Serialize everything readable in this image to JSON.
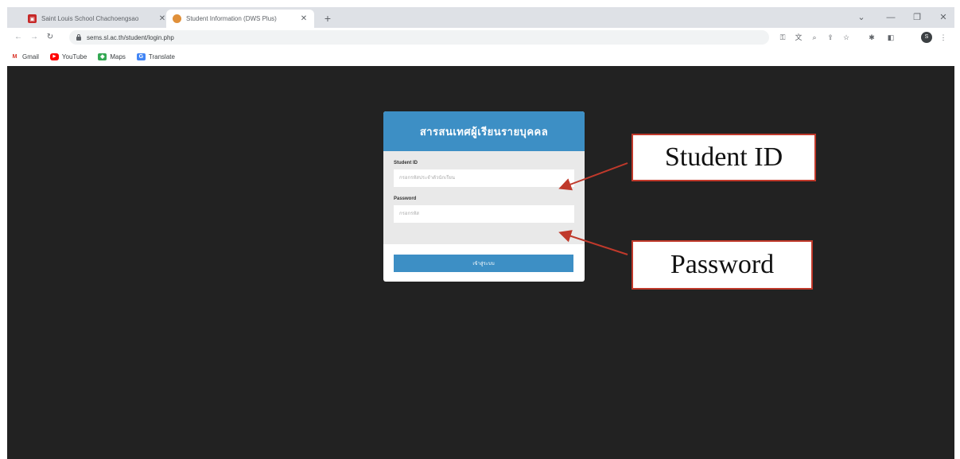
{
  "browser": {
    "tabs": [
      {
        "title": "Saint Louis School Chachoengsao",
        "active": false,
        "favicon": "school-favicon"
      },
      {
        "title": "Student Information (DWS Plus)",
        "active": true,
        "favicon": "site-favicon"
      }
    ],
    "new_tab_glyph": "+",
    "url": "sems.sl.ac.th/student/login.php",
    "bookmarks": [
      {
        "label": "Gmail",
        "icon": "gmail-icon",
        "glyph": "M"
      },
      {
        "label": "YouTube",
        "icon": "youtube-icon",
        "glyph": "▶"
      },
      {
        "label": "Maps",
        "icon": "maps-icon",
        "glyph": "◆"
      },
      {
        "label": "Translate",
        "icon": "translate-icon",
        "glyph": "G"
      }
    ],
    "profile_initial": "S"
  },
  "login": {
    "title": "สารสนเทศผู้เรียนรายบุคคล",
    "student_id_label": "Student ID",
    "student_id_placeholder": "กรอกรหัสประจำตัวนักเรียน",
    "password_label": "Password",
    "password_placeholder": "กรอกรหัส",
    "button_label": "เข้าสู่ระบบ"
  },
  "annotations": {
    "student_id": "Student ID",
    "password": "Password",
    "color": "#c0392b"
  },
  "colors": {
    "page_background": "#222222",
    "accent": "#3d8fc5",
    "card_body": "#e9e9e9"
  }
}
